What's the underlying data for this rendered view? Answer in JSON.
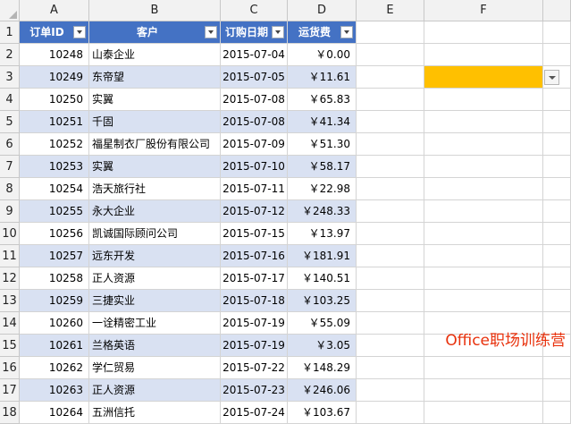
{
  "columns": [
    "A",
    "B",
    "C",
    "D",
    "E",
    "F"
  ],
  "row_numbers": [
    "1",
    "2",
    "3",
    "4",
    "5",
    "6",
    "7",
    "8",
    "9",
    "10",
    "11",
    "12",
    "13",
    "14",
    "15",
    "16",
    "17",
    "18"
  ],
  "headers": [
    "订单ID",
    "客户",
    "订购日期",
    "运货费"
  ],
  "rows": [
    {
      "id": "10248",
      "customer": "山泰企业",
      "date": "2015-07-04",
      "fee": "￥0.00"
    },
    {
      "id": "10249",
      "customer": "东帝望",
      "date": "2015-07-05",
      "fee": "￥11.61"
    },
    {
      "id": "10250",
      "customer": "实翼",
      "date": "2015-07-08",
      "fee": "￥65.83"
    },
    {
      "id": "10251",
      "customer": "千固",
      "date": "2015-07-08",
      "fee": "￥41.34"
    },
    {
      "id": "10252",
      "customer": "福星制衣厂股份有限公司",
      "date": "2015-07-09",
      "fee": "￥51.30"
    },
    {
      "id": "10253",
      "customer": "实翼",
      "date": "2015-07-10",
      "fee": "￥58.17"
    },
    {
      "id": "10254",
      "customer": "浩天旅行社",
      "date": "2015-07-11",
      "fee": "￥22.98"
    },
    {
      "id": "10255",
      "customer": "永大企业",
      "date": "2015-07-12",
      "fee": "￥248.33"
    },
    {
      "id": "10256",
      "customer": "凯诚国际顾问公司",
      "date": "2015-07-15",
      "fee": "￥13.97"
    },
    {
      "id": "10257",
      "customer": "远东开发",
      "date": "2015-07-16",
      "fee": "￥181.91"
    },
    {
      "id": "10258",
      "customer": "正人资源",
      "date": "2015-07-17",
      "fee": "￥140.51"
    },
    {
      "id": "10259",
      "customer": "三捷实业",
      "date": "2015-07-18",
      "fee": "￥103.25"
    },
    {
      "id": "10260",
      "customer": "一诠精密工业",
      "date": "2015-07-19",
      "fee": "￥55.09"
    },
    {
      "id": "10261",
      "customer": "兰格英语",
      "date": "2015-07-19",
      "fee": "￥3.05"
    },
    {
      "id": "10262",
      "customer": "学仁贸易",
      "date": "2015-07-22",
      "fee": "￥148.29"
    },
    {
      "id": "10263",
      "customer": "正人资源",
      "date": "2015-07-23",
      "fee": "￥246.06"
    },
    {
      "id": "10264",
      "customer": "五洲信托",
      "date": "2015-07-24",
      "fee": "￥103.67"
    }
  ],
  "watermark": "Office职场训练营",
  "colors": {
    "header_bg": "#4472c4",
    "band_bg": "#d9e1f2",
    "selected_cell": "#ffc000",
    "watermark": "#e8300b"
  }
}
